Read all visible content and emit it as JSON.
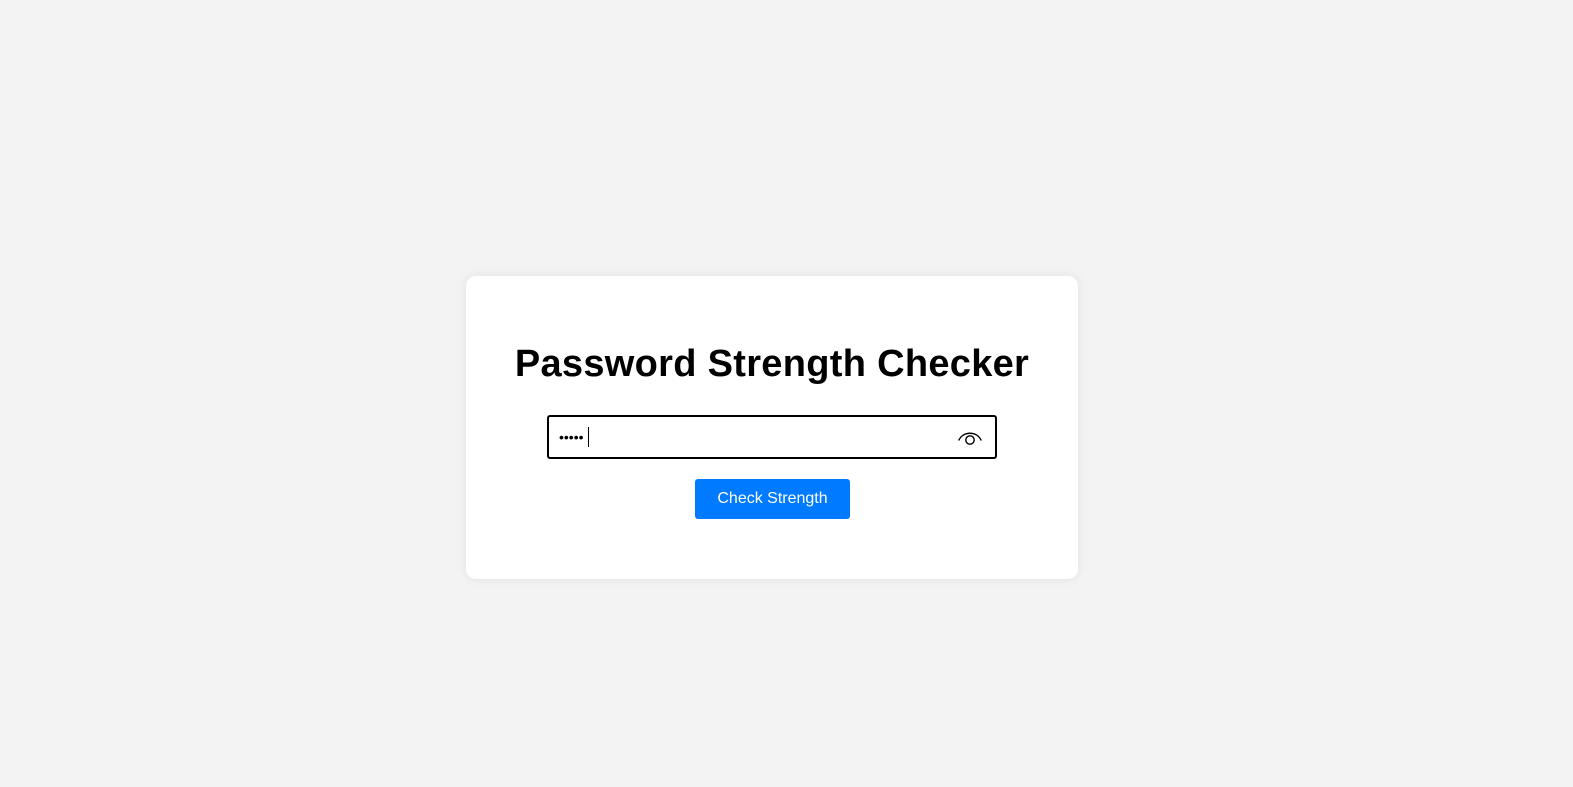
{
  "page": {
    "title": "Password Strength Checker"
  },
  "password_field": {
    "masked_value": "•••••",
    "toggle_icon": "eye-icon"
  },
  "actions": {
    "check_label": "Check Strength"
  },
  "colors": {
    "background": "#f3f3f3",
    "card": "#ffffff",
    "accent": "#007bff",
    "text": "#000000"
  }
}
